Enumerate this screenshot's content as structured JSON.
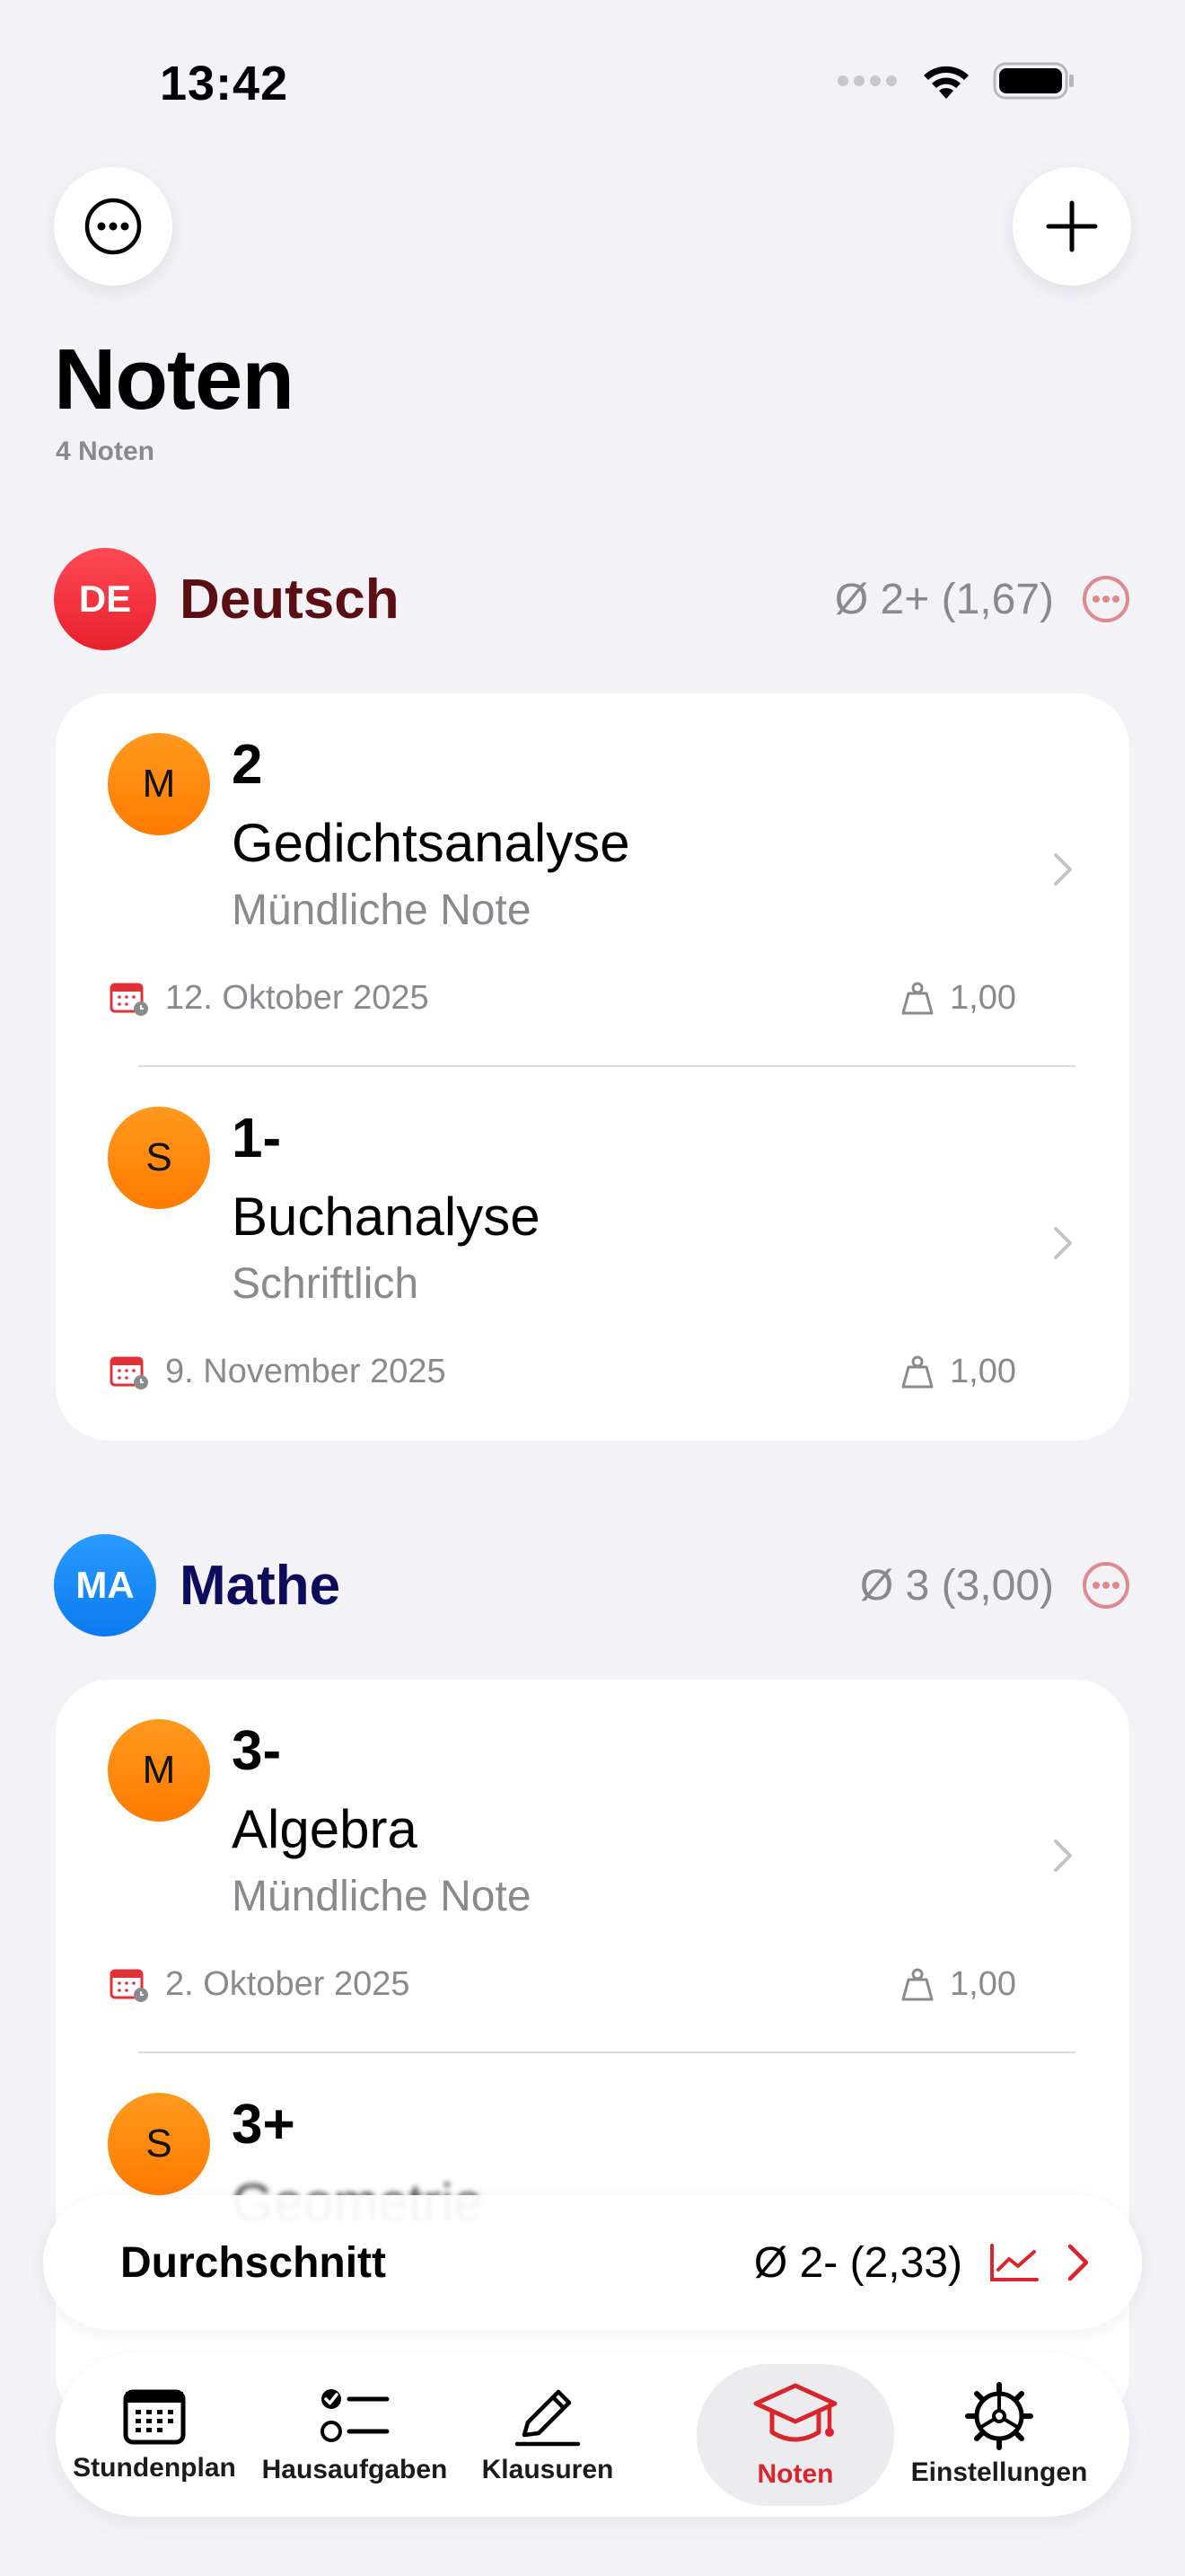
{
  "status_bar": {
    "time": "13:42"
  },
  "header": {
    "title": "Noten",
    "subtitle": "4 Noten"
  },
  "colors": {
    "accent": "#d7262e",
    "deutsch": "#5a0f12",
    "mathe": "#0c0c5a",
    "secondary_text": "#8a8a8e"
  },
  "subjects": [
    {
      "badge": "DE",
      "name": "Deutsch",
      "average": "Ø 2+ (1,67)",
      "grades": [
        {
          "type_badge": "M",
          "value": "2",
          "title": "Gedichtsanalyse",
          "type": "Mündliche Note",
          "date": "12. Oktober 2025",
          "weight": "1,00"
        },
        {
          "type_badge": "S",
          "value": "1-",
          "title": "Buchanalyse",
          "type": "Schriftlich",
          "date": "9. November 2025",
          "weight": "1,00"
        }
      ]
    },
    {
      "badge": "MA",
      "name": "Mathe",
      "average": "Ø 3 (3,00)",
      "grades": [
        {
          "type_badge": "M",
          "value": "3-",
          "title": "Algebra",
          "type": "Mündliche Note",
          "date": "2. Oktober 2025",
          "weight": "1,00"
        },
        {
          "type_badge": "S",
          "value": "3+",
          "title": "Geometrie",
          "type": "",
          "date": "",
          "weight": ""
        }
      ]
    }
  ],
  "average_bar": {
    "label": "Durchschnitt",
    "value": "Ø 2- (2,33)"
  },
  "tabs": [
    {
      "label": "Stundenplan",
      "icon": "calendar-grid-icon"
    },
    {
      "label": "Hausaufgaben",
      "icon": "checklist-icon"
    },
    {
      "label": "Klausuren",
      "icon": "pencil-icon"
    },
    {
      "label": "Noten",
      "icon": "graduation-cap-icon",
      "active": true
    },
    {
      "label": "Einstellungen",
      "icon": "gear-icon"
    }
  ]
}
